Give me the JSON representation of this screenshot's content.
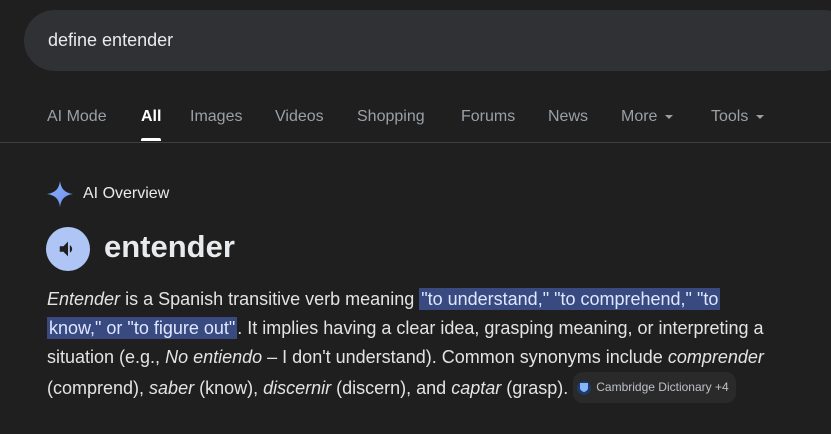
{
  "search": {
    "query": "define entender"
  },
  "tabs": [
    {
      "label": "AI Mode"
    },
    {
      "label": "All",
      "active": true
    },
    {
      "label": "Images"
    },
    {
      "label": "Videos"
    },
    {
      "label": "Shopping"
    },
    {
      "label": "Forums"
    },
    {
      "label": "News"
    },
    {
      "label": "More"
    }
  ],
  "tools": {
    "label": "Tools"
  },
  "overview": {
    "label": "AI Overview",
    "word": "entender",
    "p": {
      "t1": "Entender",
      "t2": " is a Spanish transitive verb meaning ",
      "hl1": "\"to understand,\" \"to comprehend,\" \"to",
      "hl2": "know,\" or \"to figure out\"",
      "t3": ". It implies having a clear idea, grasping meaning, or interpreting a situation (e.g., ",
      "t4": "No entiendo",
      "t5": " – I don't understand). Common synonyms include ",
      "t6": "comprender",
      "t7": " (comprend), ",
      "t8": "saber",
      "t9": " (know), ",
      "t10": "discernir",
      "t11": " (discern), and ",
      "t12": "captar",
      "t13": " (grasp). "
    },
    "source": "Cambridge Dictionary +4"
  },
  "colors": {
    "accent_star": "#8ab4f8",
    "highlight": "#394a80",
    "speaker_bg": "#aec5f5"
  }
}
